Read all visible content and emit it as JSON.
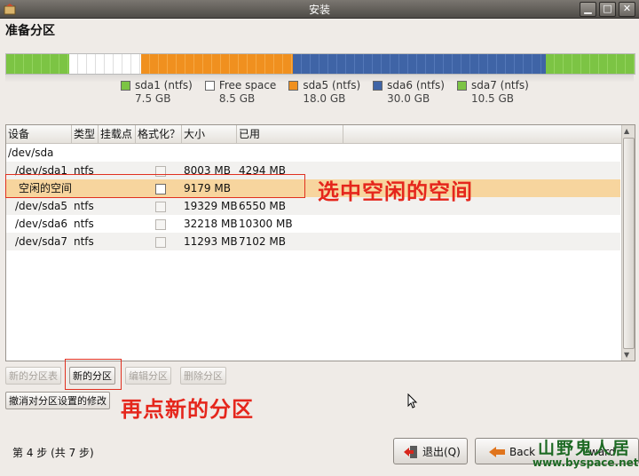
{
  "window": {
    "title": "安装",
    "heading": "准备分区"
  },
  "partition_bar": [
    {
      "name": "sda1 (ntfs)",
      "size": "7.5 GB",
      "color": "#7cc444",
      "gb": 7.5,
      "pattern": "green"
    },
    {
      "name": "Free space",
      "size": "8.5 GB",
      "color": "#ffffff",
      "gb": 8.5,
      "pattern": "white"
    },
    {
      "name": "sda5 (ntfs)",
      "size": "18.0 GB",
      "color": "#f0901f",
      "gb": 18.0,
      "pattern": "orange"
    },
    {
      "name": "sda6 (ntfs)",
      "size": "30.0 GB",
      "color": "#3f64a6",
      "gb": 30.0,
      "pattern": "blue"
    },
    {
      "name": "sda7 (ntfs)",
      "size": "10.5 GB",
      "color": "#7cc444",
      "gb": 10.5,
      "pattern": "green"
    }
  ],
  "table": {
    "headers": [
      "设备",
      "类型",
      "挂载点",
      "格式化？",
      "大小",
      "已用"
    ],
    "rows": [
      {
        "device": "/dev/sda",
        "type": "",
        "mount": "",
        "format": "",
        "size": "",
        "used": "",
        "indent": false,
        "checkbox": "none"
      },
      {
        "device": "/dev/sda1",
        "type": "ntfs",
        "mount": "",
        "format": "",
        "size": "8003 MB",
        "used": "4294 MB",
        "indent": true,
        "checkbox": "disabled"
      },
      {
        "device": "空闲的空间",
        "type": "",
        "mount": "",
        "format": "",
        "size": "9179 MB",
        "used": "",
        "indent": true,
        "checkbox": "enabled",
        "selected": true
      },
      {
        "device": "/dev/sda5",
        "type": "ntfs",
        "mount": "",
        "format": "",
        "size": "19329 MB",
        "used": "6550 MB",
        "indent": true,
        "checkbox": "disabled"
      },
      {
        "device": "/dev/sda6",
        "type": "ntfs",
        "mount": "",
        "format": "",
        "size": "32218 MB",
        "used": "10300 MB",
        "indent": true,
        "checkbox": "disabled"
      },
      {
        "device": "/dev/sda7",
        "type": "ntfs",
        "mount": "",
        "format": "",
        "size": "11293 MB",
        "used": "7102 MB",
        "indent": true,
        "checkbox": "disabled"
      }
    ]
  },
  "buttons": {
    "new_table": "新的分区表",
    "new_partition": "新的分区",
    "edit_partition": "编辑分区",
    "delete_partition": "删除分区",
    "revert": "撤消对分区设置的修改"
  },
  "annotations": {
    "select": "选中空闲的空间",
    "click_new": "再点新的分区"
  },
  "footer": {
    "step": "第 4 步 (共 7 步)",
    "quit": "退出(Q)",
    "back": "Back",
    "forward": "ward"
  },
  "watermark": {
    "brand": "山野鬼人居",
    "url": "www.byspace.net"
  }
}
